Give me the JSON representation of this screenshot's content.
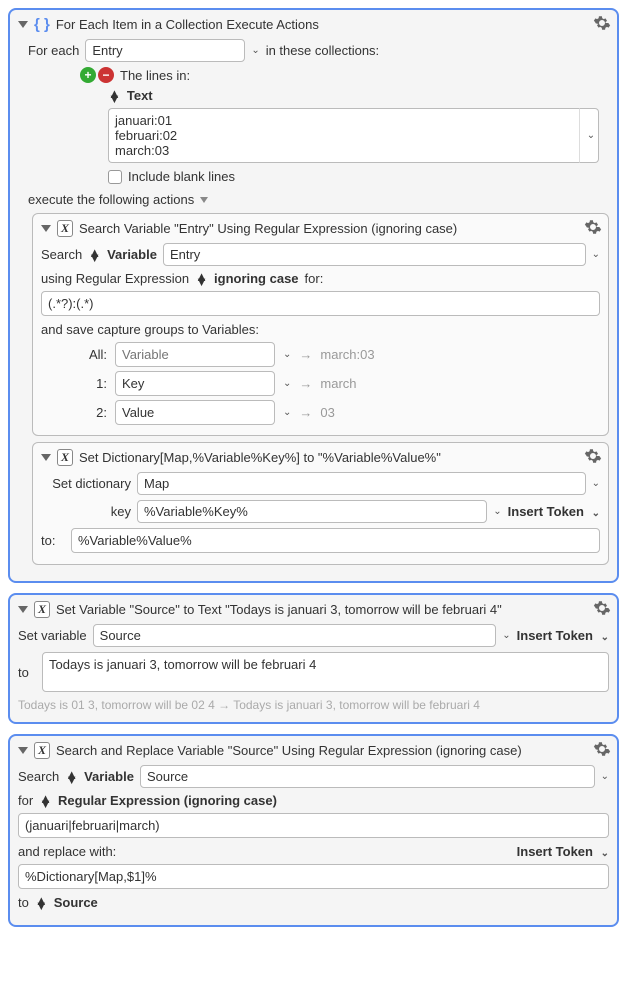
{
  "forEach": {
    "title": "For Each Item in a Collection Execute Actions",
    "forEachLabel": "For each",
    "varName": "Entry",
    "inThese": "in these collections:",
    "linesIn": "The lines in:",
    "textLabel": "Text",
    "textContent": "januari:01\nfebruari:02\nmarch:03",
    "includeBlank": "Include blank lines",
    "executeLabel": "execute the following actions"
  },
  "searchVar": {
    "title": "Search Variable \"Entry\" Using Regular Expression (ignoring case)",
    "searchLabel": "Search",
    "varToken": "Variable",
    "varName": "Entry",
    "usingLabel": "using Regular Expression",
    "ignoring": "ignoring case",
    "forLabel": "for:",
    "regex": "(.*?):(.*)",
    "saveLabel": "and save capture groups to Variables:",
    "allLabel": "All:",
    "allPlaceholder": "Variable",
    "allResult": "march:03",
    "oneLabel": "1:",
    "oneVal": "Key",
    "oneResult": "march",
    "twoLabel": "2:",
    "twoVal": "Value",
    "twoResult": "03"
  },
  "setDict": {
    "title": "Set Dictionary[Map,%Variable%Key%] to \"%Variable%Value%\"",
    "setLabel": "Set dictionary",
    "dictName": "Map",
    "keyLabel": "key",
    "keyVal": "%Variable%Key%",
    "insertToken": "Insert Token",
    "toLabel": "to:",
    "toVal": "%Variable%Value%"
  },
  "setVar": {
    "title": "Set Variable \"Source\" to Text \"Todays is januari 3, tomorrow will be februari 4\"",
    "setLabel": "Set variable",
    "varName": "Source",
    "insertToken": "Insert Token",
    "toLabel": "to",
    "toVal": "Todays is januari 3, tomorrow will be februari 4",
    "preview": "Todays is 01 3, tomorrow will be 02 4 → Todays is januari 3, tomorrow will be februari 4"
  },
  "searchReplace": {
    "title": "Search and Replace Variable \"Source\" Using Regular Expression (ignoring case)",
    "searchLabel": "Search",
    "varToken": "Variable",
    "varName": "Source",
    "forLabel": "for",
    "regexMode": "Regular Expression (ignoring case)",
    "regex": "(januari|februari|march)",
    "replaceLabel": "and replace with:",
    "insertToken": "Insert Token",
    "replaceVal": "%Dictionary[Map,$1]%",
    "toLabel": "to",
    "toTarget": "Source"
  }
}
